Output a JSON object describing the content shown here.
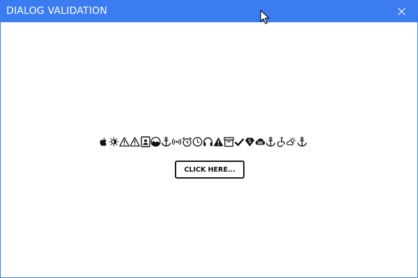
{
  "window": {
    "title": "DIALOG VALIDATION",
    "accent_color": "#3b7cf0",
    "close_icon": "close-icon"
  },
  "content": {
    "icons": [
      "apple-icon",
      "brightness-icon",
      "warning-outline-icon",
      "warning-outline-icon",
      "contact-card-icon",
      "landscape-circle-icon",
      "anchor-icon",
      "broadcast-icon",
      "alarm-clock-icon",
      "clock-icon",
      "headphones-icon",
      "warning-filled-icon",
      "archive-box-icon",
      "checkmark-icon",
      "superhero-shield-icon",
      "creative-cloud-icon",
      "anchor-icon",
      "wheelchair-active-icon",
      "partly-cloudy-icon",
      "anchor-icon"
    ],
    "button_label": "CLICK HERE..."
  }
}
